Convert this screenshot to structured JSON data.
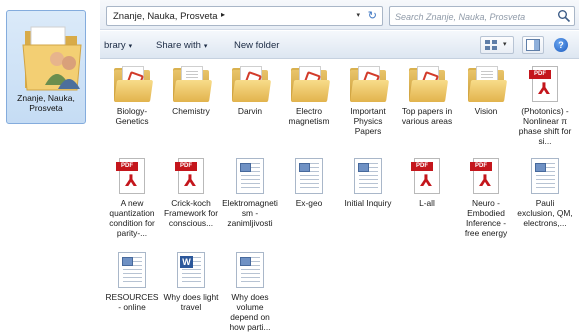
{
  "selected_folder": {
    "name": "Znanje, Nauka, Prosveta"
  },
  "address": {
    "breadcrumb": "Znanje, Nauka, Prosveta",
    "crumb_arrow": "▸",
    "dropdown": "▾",
    "refresh": "↻"
  },
  "search": {
    "placeholder": "Search Znanje, Nauka, Prosveta",
    "icon": "search-icon"
  },
  "toolbar": {
    "library": "brary",
    "share_with": "Share with",
    "new_folder": "New folder",
    "arrow": "▾",
    "help": "?"
  },
  "items": [
    {
      "name": "Biology-Genetics",
      "type": "folder",
      "paper": "red"
    },
    {
      "name": "Chemistry",
      "type": "folder",
      "paper": "gray"
    },
    {
      "name": "Darvin",
      "type": "folder",
      "paper": "red"
    },
    {
      "name": "Electro magnetism",
      "type": "folder",
      "paper": "red"
    },
    {
      "name": "Important Physics Papers",
      "type": "folder",
      "paper": "red"
    },
    {
      "name": "Top papers in various areas",
      "type": "folder",
      "paper": "red"
    },
    {
      "name": "Vision",
      "type": "folder",
      "paper": "gray"
    },
    {
      "name": "(Photonics) - Nonlinear π phase shift for si...",
      "type": "pdf"
    },
    {
      "name": "A new quantization condition for parity-...",
      "type": "pdf"
    },
    {
      "name": "Crick-koch Framework for conscious...",
      "type": "pdf"
    },
    {
      "name": "Elektromagnetism - zanimljivosti",
      "type": "doc"
    },
    {
      "name": "Ex-geo",
      "type": "doc"
    },
    {
      "name": "Initial Inquiry",
      "type": "doc"
    },
    {
      "name": "L-all",
      "type": "pdf"
    },
    {
      "name": "Neuro - Embodied Inference - free energy",
      "type": "pdf"
    },
    {
      "name": "Pauli exclusion, QM, electrons,...",
      "type": "doc"
    },
    {
      "name": "RESOURCES - online",
      "type": "doc"
    },
    {
      "name": "Why does light travel",
      "type": "word"
    },
    {
      "name": "Why does volume depend on how parti...",
      "type": "doc"
    }
  ],
  "pdf_label": "PDF",
  "word_label": "W",
  "colors": {
    "selection": "#c5dcf4",
    "pdf_red": "#c4161c",
    "folder": "#e2b34d"
  }
}
